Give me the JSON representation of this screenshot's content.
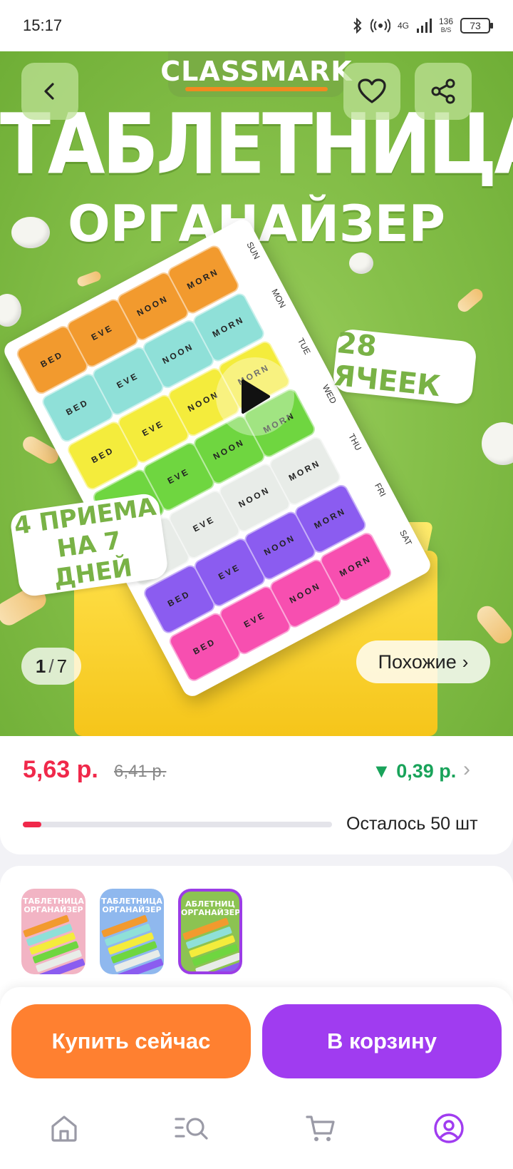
{
  "status_bar": {
    "time": "15:17",
    "network": "4G",
    "speed_value": "136",
    "speed_unit": "B/S",
    "battery": "73"
  },
  "hero": {
    "brand": "CLASSMARK",
    "title": "ТАБЛЕТНИЦА",
    "subtitle": "ОРГАНАЙЗЕР",
    "badge_cells": "28 ЯЧЕЕК",
    "badge_doses": "4 ПРИЕМА\nНА 7 ДНЕЙ",
    "days": [
      "SUN",
      "MON",
      "TUE",
      "WED",
      "THU",
      "FRI",
      "SAT"
    ],
    "slot_labels": [
      "MORN",
      "NOON",
      "EVE",
      "BED"
    ],
    "counter_current": "1",
    "counter_total": "7",
    "similar_label": "Похожие",
    "icons": {
      "back": "chevron-left-icon",
      "favorite": "heart-icon",
      "share": "share-icon",
      "play": "play-icon"
    }
  },
  "price": {
    "current": "5,63 р.",
    "old": "6,41 р.",
    "discount": "▼ 0,39 р.",
    "stock_text": "Осталось 50 шт",
    "stock_fraction": 0.06,
    "accent_color": "#f0284a",
    "discount_color": "#19a35a"
  },
  "thumbnails": [
    {
      "title": "ТАБЛЕТНИЦА ОРГАНАЙЗЕР",
      "bg": "#f2b4c4",
      "selected": false
    },
    {
      "title": "ТАБЛЕТНИЦА ОРГАНАЙЗЕР",
      "bg": "#8fb8ee",
      "selected": false
    },
    {
      "title": "АБЛЕТНИЦ ОРГАНАЙЗЕР",
      "bg": "#8cc352",
      "selected": true
    }
  ],
  "actions": {
    "buy_now": "Купить сейчас",
    "add_to_cart": "В корзину",
    "buy_color": "#ff8030",
    "cart_color": "#a03cf0"
  },
  "bottom_nav": {
    "items": [
      "home-icon",
      "catalog-search-icon",
      "cart-icon",
      "profile-icon"
    ],
    "active": "profile-icon",
    "active_color": "#a03cf0"
  }
}
